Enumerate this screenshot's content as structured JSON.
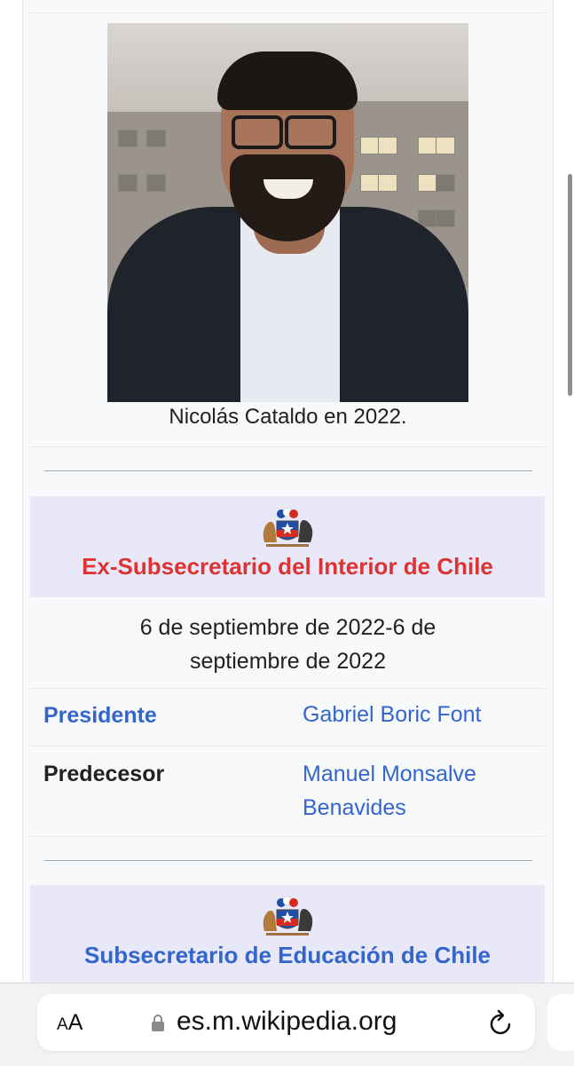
{
  "infobox": {
    "photo_caption": "Nicolás Cataldo en 2022.",
    "section1": {
      "title": "Ex-Subsecretario del Interior de Chile",
      "title_color": "#d33",
      "dates": "6 de septiembre de 2022-6 de septiembre de 2022",
      "rows": [
        {
          "label": "Presidente",
          "label_color": "#3366cc",
          "value": "Gabriel Boric Font"
        },
        {
          "label": "Predecesor",
          "label_color": "#202122",
          "value": "Manuel Monsalve Benavides"
        }
      ]
    },
    "section2": {
      "title": "Subsecretario de Educación de Chile",
      "title_color": "#3366cc"
    },
    "coat_of_arms_icon": "chile-coat-of-arms-icon"
  },
  "browser": {
    "text_size_label": "AA",
    "lock_icon": "lock-icon",
    "url": "es.m.wikipedia.org",
    "reload_icon": "reload-icon"
  }
}
